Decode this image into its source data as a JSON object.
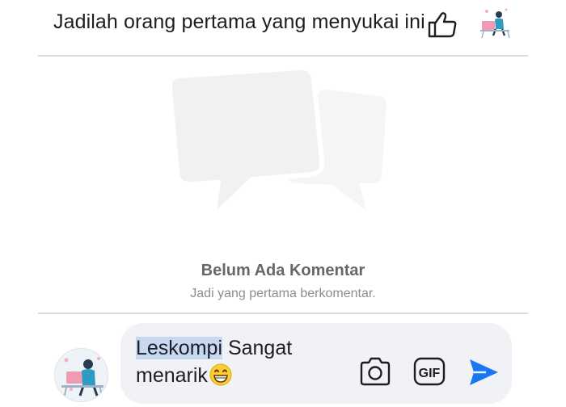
{
  "like_prompt": "Jadilah orang pertama yang menyukai ini",
  "empty_state": {
    "title": "Belum Ada Komentar",
    "subtitle": "Jadi yang pertama berkomentar."
  },
  "composer": {
    "selected_word": "Leskompi",
    "rest_text": " Sangat menarik",
    "emoji": "grinning-face-emoji",
    "gif_label": "GIF"
  },
  "colors": {
    "accent": "#1877f2",
    "text": "#1c1e21",
    "muted": "#65676b",
    "input_bg": "#f0f2f5"
  }
}
